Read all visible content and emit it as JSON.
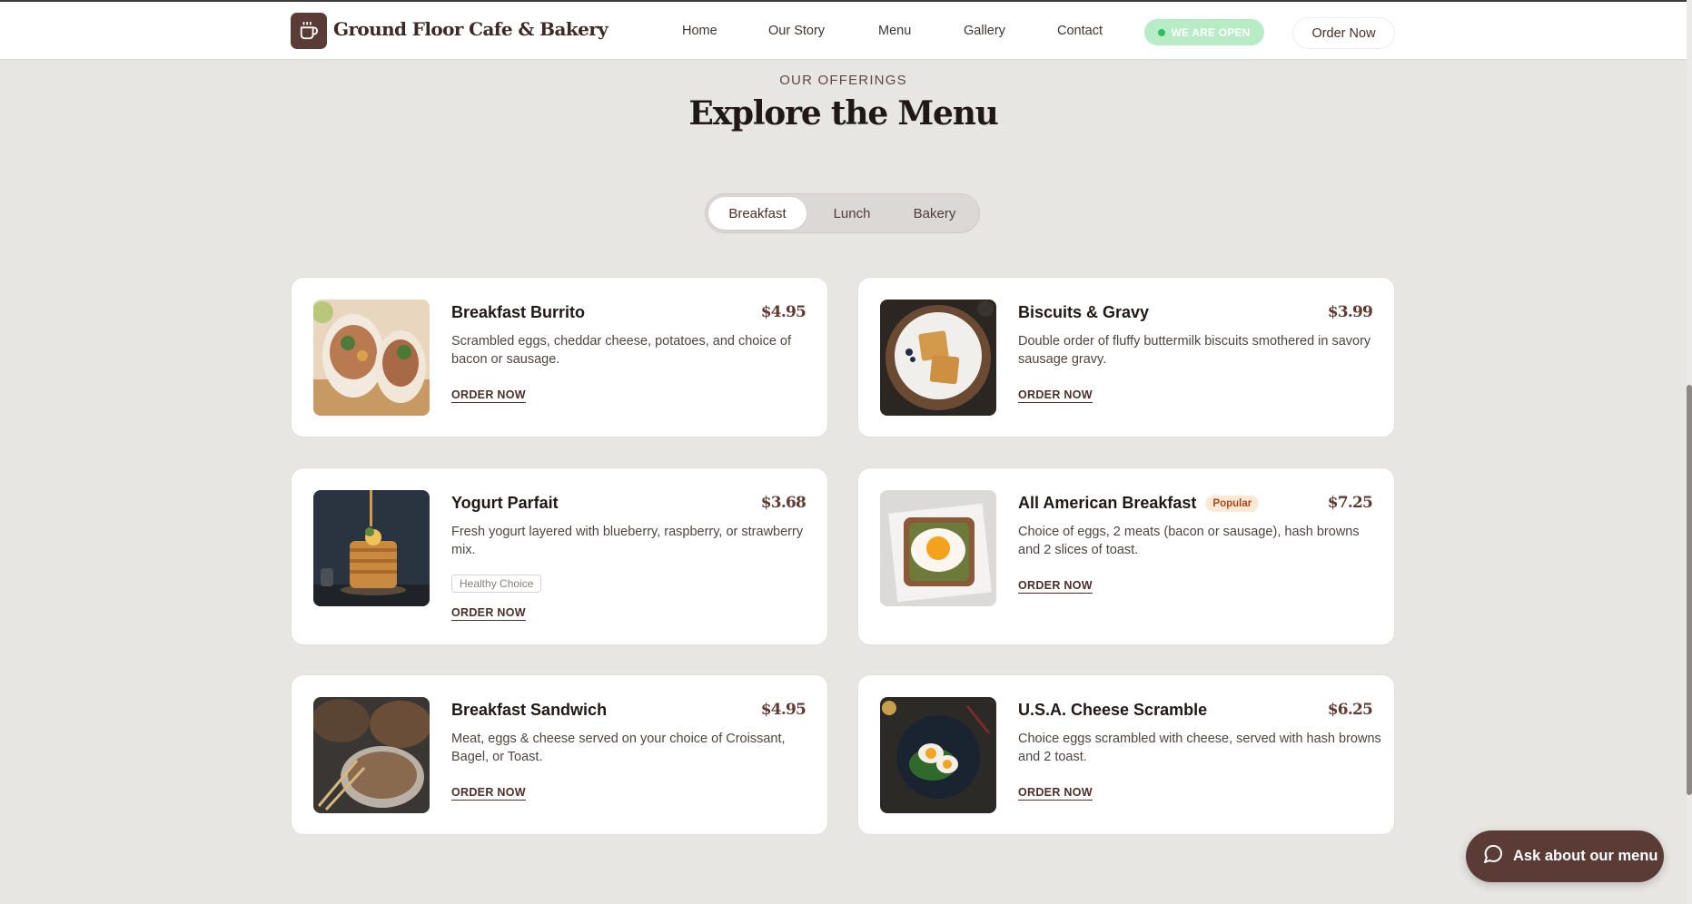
{
  "header": {
    "brand": "Ground Floor Cafe & Bakery",
    "logo_icon": "coffee-cup-icon",
    "nav": [
      "Home",
      "Our Story",
      "Menu",
      "Gallery",
      "Contact"
    ],
    "status_badge": "WE ARE OPEN",
    "order_button": "Order Now"
  },
  "section": {
    "eyebrow": "OUR OFFERINGS",
    "title": "Explore the Menu"
  },
  "tabs": {
    "items": [
      "Breakfast",
      "Lunch",
      "Bakery"
    ],
    "active": "Breakfast"
  },
  "menu": {
    "order_label": "ORDER NOW",
    "items": [
      {
        "name": "Breakfast Burrito",
        "price": "$4.95",
        "description": "Scrambled eggs, cheddar cheese, potatoes, and choice of bacon or sausage.",
        "image": "burrito-photo"
      },
      {
        "name": "Biscuits & Gravy",
        "price": "$3.99",
        "description": "Double order of fluffy buttermilk biscuits smothered in savory sausage gravy.",
        "image": "waffles-photo"
      },
      {
        "name": "Yogurt Parfait",
        "price": "$3.68",
        "description": "Fresh yogurt layered with blueberry, raspberry, or strawberry mix.",
        "tag": "Healthy Choice",
        "image": "pancake-stack-photo"
      },
      {
        "name": "All American Breakfast",
        "price": "$7.25",
        "badge": "Popular",
        "description": "Choice of eggs, 2 meats (bacon or sausage), hash browns and 2 slices of toast.",
        "image": "egg-toast-photo"
      },
      {
        "name": "Breakfast Sandwich",
        "price": "$4.95",
        "description": "Meat, eggs & cheese served on your choice of Croissant, Bagel, or Toast.",
        "image": "bread-loaves-photo"
      },
      {
        "name": "U.S.A. Cheese Scramble",
        "price": "$6.25",
        "description": "Choice eggs scrambled with cheese, served with hash browns and 2 toast.",
        "image": "egg-salad-photo"
      }
    ]
  },
  "chat": {
    "label": "Ask about our menu",
    "icon": "chat-bubble-icon"
  },
  "colors": {
    "brand": "#5b3b35",
    "page_background": "#e8e6e3",
    "open_badge": "#b7ecc6",
    "popular_badge": "#fde8d5"
  }
}
